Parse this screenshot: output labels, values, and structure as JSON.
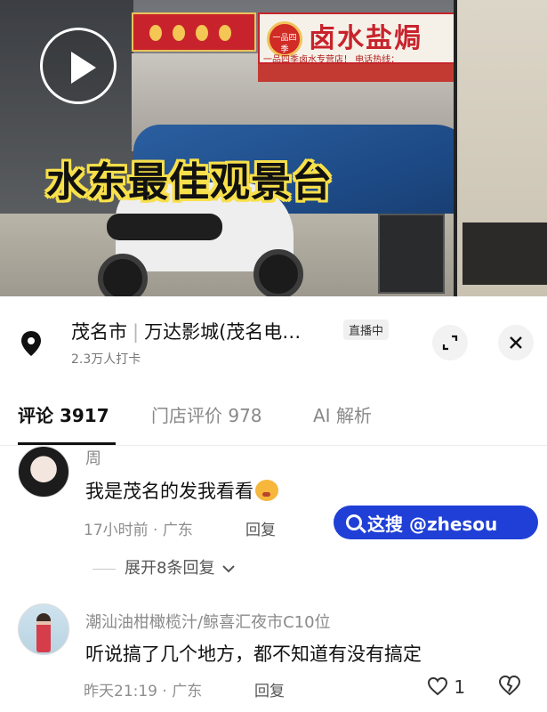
{
  "video": {
    "overlay_title": "水东最佳观景台",
    "sign_main": "卤水盐焗",
    "sign_logo": "一品四季",
    "sign_sub": "一品四季卤水专营店！  电话热线："
  },
  "location": {
    "city": "茂名市",
    "place": "万达影城(茂名电…",
    "live_badge": "直播中",
    "checkins": "2.3万人打卡"
  },
  "tabs": [
    {
      "label": "评论 3917",
      "active": true
    },
    {
      "label": "门店评价 978",
      "active": false
    },
    {
      "label": "AI 解析",
      "active": false
    }
  ],
  "comments": [
    {
      "user": "周",
      "text": "我是茂名的发我看看",
      "time": "17小时前",
      "region": "广东",
      "reply": "回复",
      "expand": "展开8条回复"
    },
    {
      "user": "潮汕油柑橄榄汁/鲸喜汇夜市C10位",
      "text": "听说搞了几个地方，都不知道有没有搞定",
      "time": "昨天21:19",
      "region": "广东",
      "reply": "回复",
      "likes": "1"
    }
  ],
  "watermark": "这搜 @zhesou",
  "icons": {
    "play": "play-icon",
    "location": "location-pin-icon",
    "expand": "expand-icon",
    "close": "close-icon",
    "chevron": "chevron-down-icon",
    "like": "heart-icon",
    "dislike": "broken-heart-icon"
  }
}
